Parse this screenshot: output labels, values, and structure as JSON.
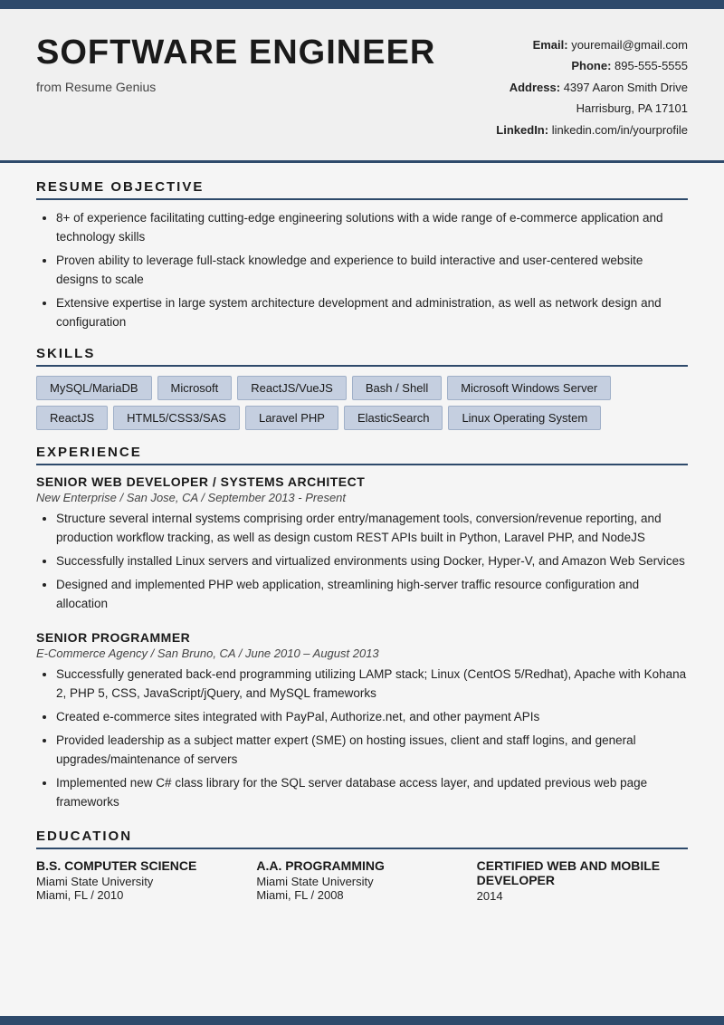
{
  "topBar": {},
  "header": {
    "title": "SOFTWARE ENGINEER",
    "subtitle": "from Resume Genius",
    "email_label": "Email:",
    "email_value": "youremail@gmail.com",
    "phone_label": "Phone:",
    "phone_value": "895-555-5555",
    "address_label": "Address:",
    "address_line1": "4397 Aaron Smith Drive",
    "address_line2": "Harrisburg, PA 17101",
    "linkedin_label": "LinkedIn:",
    "linkedin_value": "linkedin.com/in/yourprofile"
  },
  "sections": {
    "objective": {
      "title": "RESUME OBJECTIVE",
      "bullets": [
        "8+ of experience facilitating cutting-edge engineering solutions with a wide range of e-commerce application and technology skills",
        "Proven ability to leverage full-stack knowledge and experience to build interactive and user-centered website designs to scale",
        "Extensive expertise in large system architecture development and administration, as well as network design and configuration"
      ]
    },
    "skills": {
      "title": "SKILLS",
      "row1": [
        "MySQL/MariaDB",
        "Microsoft",
        "ReactJS/VueJS",
        "Bash / Shell",
        "Microsoft Windows Server"
      ],
      "row2": [
        "ReactJS",
        "HTML5/CSS3/SAS",
        "Laravel PHP",
        "ElasticSearch",
        "Linux Operating System"
      ]
    },
    "experience": {
      "title": "EXPERIENCE",
      "jobs": [
        {
          "title": "SENIOR WEB DEVELOPER / SYSTEMS ARCHITECT",
          "subtitle": "New Enterprise / San Jose, CA / September 2013 - Present",
          "bullets": [
            "Structure several internal systems comprising order entry/management tools, conversion/revenue reporting, and production workflow tracking, as well as design custom REST APIs built in Python, Laravel PHP, and NodeJS",
            "Successfully installed Linux servers and virtualized environments using Docker, Hyper-V, and Amazon Web Services",
            "Designed and implemented PHP web application, streamlining high-server traffic resource configuration and allocation"
          ]
        },
        {
          "title": "SENIOR PROGRAMMER",
          "subtitle": "E-Commerce Agency / San Bruno, CA / June 2010 – August 2013",
          "bullets": [
            "Successfully generated back-end programming utilizing LAMP stack; Linux (CentOS 5/Redhat), Apache with Kohana 2, PHP 5, CSS, JavaScript/jQuery, and MySQL frameworks",
            "Created e-commerce sites integrated with PayPal, Authorize.net, and other payment APIs",
            "Provided leadership as a subject matter expert (SME) on hosting issues, client and staff logins, and general upgrades/maintenance of servers",
            "Implemented new C# class library for the SQL server database access layer, and updated previous web page frameworks"
          ]
        }
      ]
    },
    "education": {
      "title": "EDUCATION",
      "items": [
        {
          "degree": "B.S. COMPUTER SCIENCE",
          "school": "Miami State University",
          "detail": "Miami, FL / 2010",
          "year": ""
        },
        {
          "degree": "A.A. PROGRAMMING",
          "school": "Miami State University",
          "detail": "Miami, FL / 2008",
          "year": ""
        },
        {
          "degree": "CERTIFIED WEB AND MOBILE DEVELOPER",
          "school": "",
          "detail": "",
          "year": "2014"
        }
      ]
    }
  }
}
